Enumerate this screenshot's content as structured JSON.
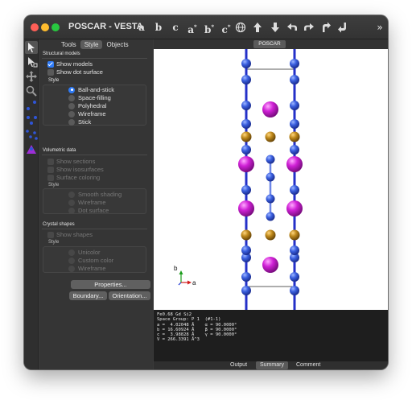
{
  "window": {
    "title": "POSCAR - VESTA"
  },
  "toolbar": {
    "buttons": [
      {
        "letter": "a",
        "sup": ""
      },
      {
        "letter": "b",
        "sup": ""
      },
      {
        "letter": "c",
        "sup": ""
      },
      {
        "letter": "a",
        "sup": "*"
      },
      {
        "letter": "b",
        "sup": "*"
      },
      {
        "letter": "c",
        "sup": "*"
      }
    ],
    "overflow": "»"
  },
  "side_tabs": [
    "Tools",
    "Style",
    "Objects"
  ],
  "structural": {
    "title": "Structural models",
    "show_models": "Show models",
    "show_dot_surface": "Show dot surface",
    "style_label": "Style",
    "styles": [
      "Ball-and-stick",
      "Space-filling",
      "Polyhedral",
      "Wireframe",
      "Stick"
    ]
  },
  "volumetric": {
    "title": "Volumetric data",
    "show_sections": "Show sections",
    "show_isosurfaces": "Show isosurfaces",
    "surface_coloring": "Surface coloring",
    "style_label": "Style",
    "styles": [
      "Smooth shading",
      "Wireframe",
      "Dot surface"
    ]
  },
  "crystal_shapes": {
    "title": "Crystal shapes",
    "show_shapes": "Show shapes",
    "style_label": "Style",
    "styles": [
      "Unicolor",
      "Custom color",
      "Wireframe"
    ]
  },
  "buttons": {
    "properties": "Properties...",
    "boundary": "Boundary...",
    "orientation": "Orientation..."
  },
  "viewport": {
    "tab": "POSCAR",
    "axis_b": "b",
    "axis_a": "a"
  },
  "info": {
    "lines": [
      "Fe0.68 Gd Si2",
      "Space Group: P 1  (#1-1)",
      "a =  4.02048 Å    α = 90.0000°",
      "b = 16.60924 Å    β = 90.0000°",
      "c =  3.98828 Å    γ = 90.0000°",
      "V = 266.3391 Å^3"
    ]
  },
  "bottom_tabs": [
    "Output",
    "Summary",
    "Comment"
  ],
  "colors": {
    "accent": "#2f7bf6",
    "si": "#2f55d8",
    "fe": "#b8860b",
    "gd": "#c51ec9",
    "bond": "#2430c8"
  }
}
